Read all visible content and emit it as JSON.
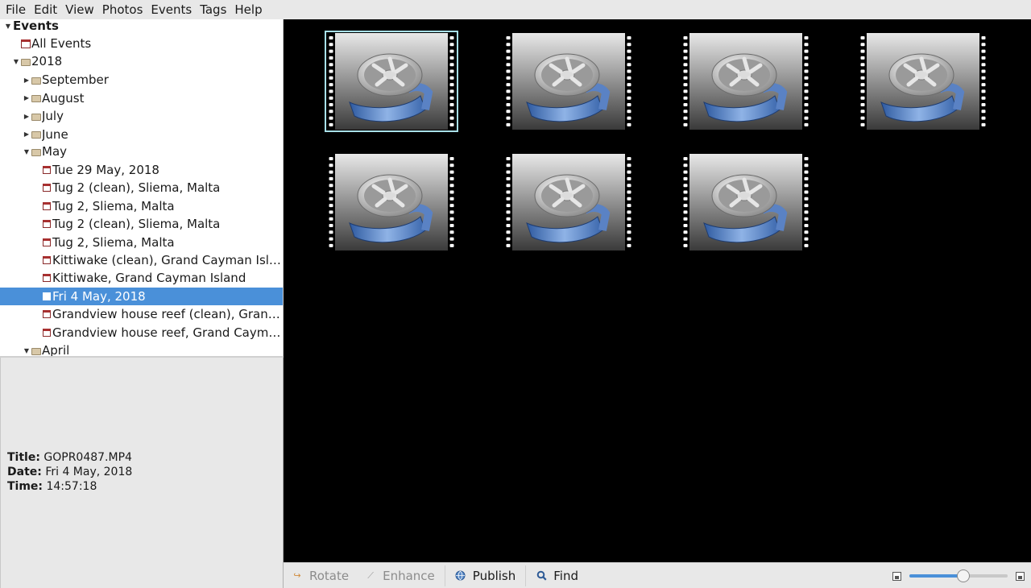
{
  "menubar": [
    "File",
    "Edit",
    "View",
    "Photos",
    "Events",
    "Tags",
    "Help"
  ],
  "sidebar": {
    "header": "Events",
    "all_events": "All Events",
    "year": "2018",
    "months_collapsed": [
      "September",
      "August",
      "July",
      "June"
    ],
    "may": "May",
    "events": [
      "Tue 29 May, 2018",
      "Tug 2 (clean), Sliema, Malta",
      "Tug 2, Sliema, Malta",
      "Tug 2 (clean), Sliema, Malta",
      "Tug 2, Sliema, Malta",
      "Kittiwake (clean), Grand Cayman Isl…",
      "Kittiwake, Grand Cayman Island",
      "Fri 4 May, 2018",
      "Grandview house reef (clean), Gran…",
      "Grandview house reef, Grand Caym…"
    ],
    "selected_event_index": 7,
    "april": "April"
  },
  "info": {
    "title_label": "Title:",
    "title_value": "GOPR0487.MP4",
    "date_label": "Date:",
    "date_value": "Fri 4 May, 2018",
    "time_label": "Time:",
    "time_value": "14:57:18"
  },
  "viewer": {
    "thumbnail_count": 7,
    "thumbnail_icon": "film-reel-icon",
    "selected_index": 0,
    "background": "#000000"
  },
  "toolbar": {
    "rotate": "Rotate",
    "enhance": "Enhance",
    "publish": "Publish",
    "find": "Find"
  },
  "zoom": {
    "level": 0.55
  },
  "colors": {
    "accent": "#4a90d9",
    "selection_outline": "#a8e0e8"
  }
}
